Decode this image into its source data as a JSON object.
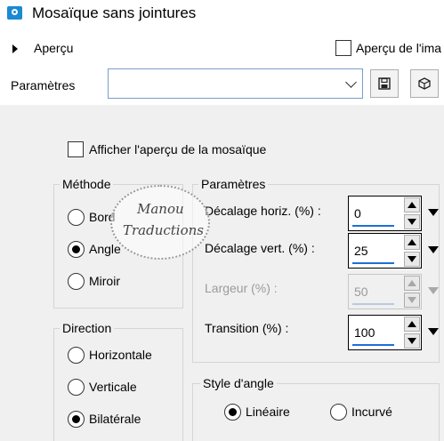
{
  "window": {
    "title": "Mosaïque sans jointures",
    "icon": "camera-icon"
  },
  "preview": {
    "label": "Aperçu",
    "image_preview_label": "Aperçu de l'ima"
  },
  "presets": {
    "label": "Paramètres",
    "value": ""
  },
  "tile_preview": {
    "label": "Afficher l'aperçu de la mosaïque"
  },
  "method": {
    "title": "Méthode",
    "options": [
      "Bord",
      "Angle",
      "Miroir"
    ],
    "selected": "Angle"
  },
  "parameters": {
    "title": "Paramètres",
    "fields": [
      {
        "label": "Décalage horiz. (%) :",
        "value": "0",
        "enabled": true
      },
      {
        "label": "Décalage vert. (%) :",
        "value": "25",
        "enabled": true
      },
      {
        "label": "Largeur (%) :",
        "value": "50",
        "enabled": false
      },
      {
        "label": "Transition (%) :",
        "value": "100",
        "enabled": true
      }
    ]
  },
  "direction": {
    "title": "Direction",
    "options": [
      "Horizontale",
      "Verticale",
      "Bilatérale"
    ],
    "selected": "Bilatérale"
  },
  "corner_style": {
    "title": "Style d'angle",
    "options": [
      "Linéaire",
      "Incurvé"
    ],
    "selected": "Linéaire"
  },
  "watermark": {
    "line1": "Manou",
    "line2": "Traductions"
  },
  "colors": {
    "accent": "#1e6fd9",
    "title_icon": "#1a8ad4",
    "window_bg": "#f0f0f0"
  }
}
